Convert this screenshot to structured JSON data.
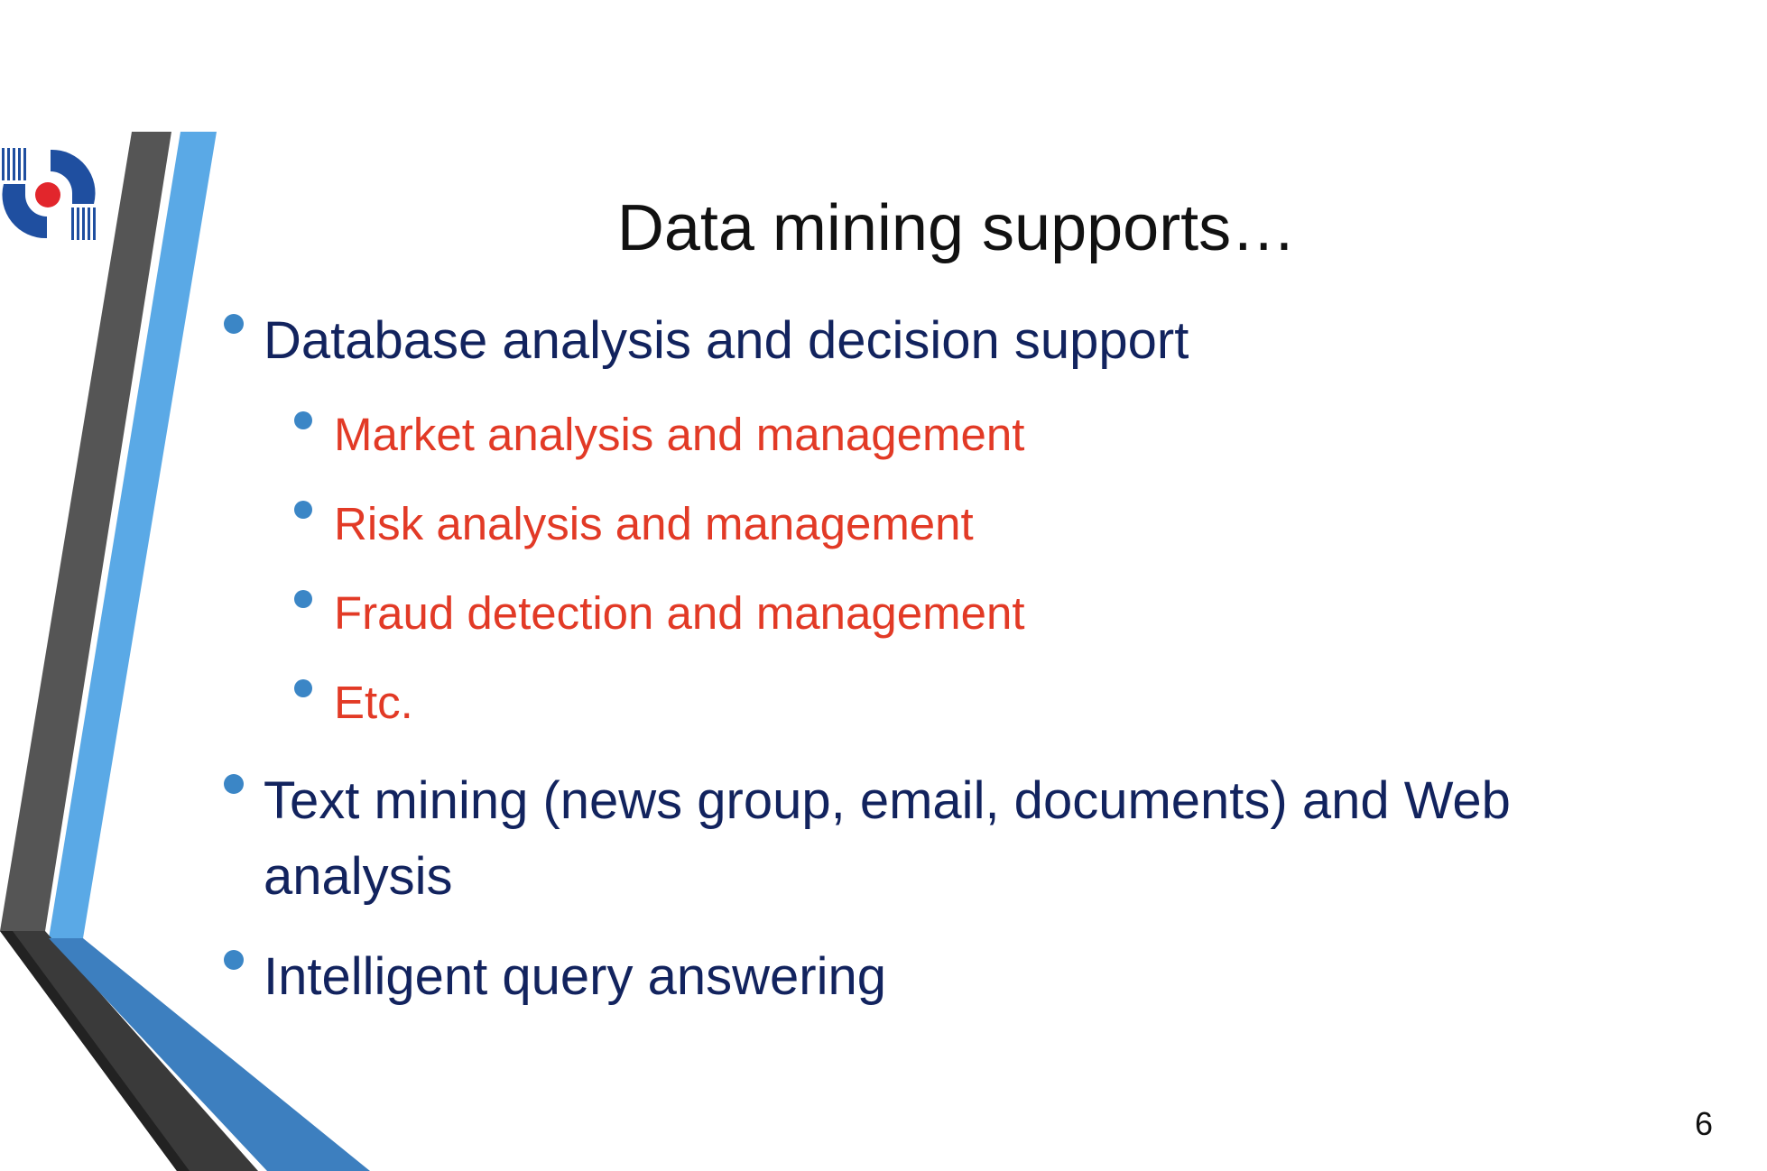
{
  "slide": {
    "title": "Data mining supports…",
    "bullets": [
      {
        "label": "Database analysis and decision support",
        "level": 1
      },
      {
        "label": "Market analysis and management",
        "level": 2
      },
      {
        "label": "Risk analysis and management",
        "level": 2
      },
      {
        "label": "Fraud detection and management",
        "level": 2
      },
      {
        "label": "Etc.",
        "level": 2
      },
      {
        "label": "Text mining (news group, email, documents) and Web",
        "label_line2": "analysis",
        "level": 1
      },
      {
        "label": "Intelligent query answering",
        "level": 1
      }
    ],
    "page_number": "6"
  },
  "colors": {
    "title_text": "#111111",
    "level1_text": "#12235e",
    "level2_text": "#e23a26",
    "bullet_dot": "#3b86c6",
    "stripe_dark": "#555555",
    "stripe_light_blue": "#5aa9e6",
    "stripe_blue": "#3d7fbf",
    "logo_blue": "#1f4fa0",
    "logo_red": "#e2262c"
  },
  "decor_icons": [
    "logo-icon",
    "side-stripes"
  ]
}
